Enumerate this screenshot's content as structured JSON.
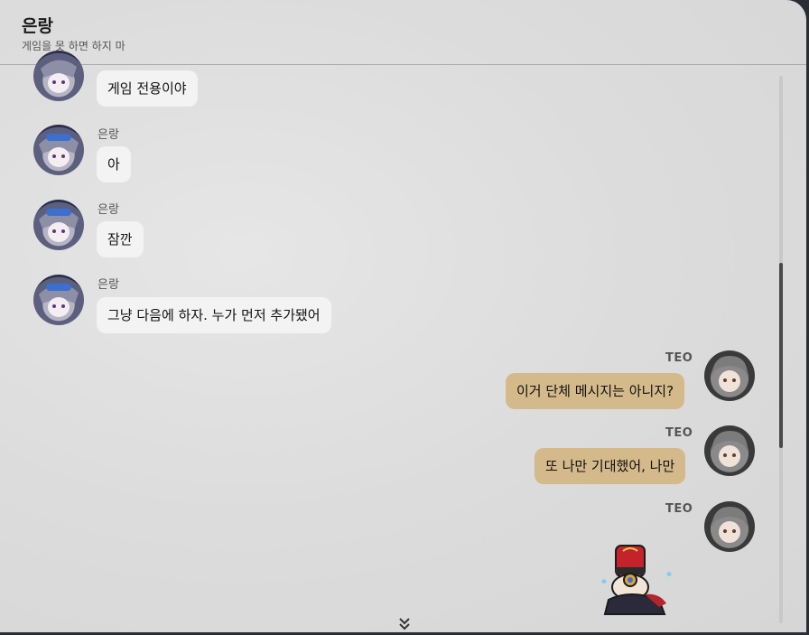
{
  "header": {
    "title": "은랑",
    "subtitle": "게임을 못 하면 하지 마"
  },
  "messages": [
    {
      "sender": "",
      "text": "게임 전용이야"
    },
    {
      "sender": "은랑",
      "text": "아"
    },
    {
      "sender": "은랑",
      "text": "잠깐"
    },
    {
      "sender": "은랑",
      "text": "그냥 다음에 하자. 누가 먼저 추가됐어"
    },
    {
      "sender": "TEO",
      "text": "이거 단체 메시지는 아니지?"
    },
    {
      "sender": "TEO",
      "text": "또 나만 기대했어, 나만"
    },
    {
      "sender": "TEO",
      "text": ""
    }
  ],
  "icons": {
    "scroll_down": "chevron-double-down-icon"
  },
  "colors": {
    "outgoing_bubble": "#d4b98b",
    "incoming_bubble": "#f3f3f3"
  }
}
